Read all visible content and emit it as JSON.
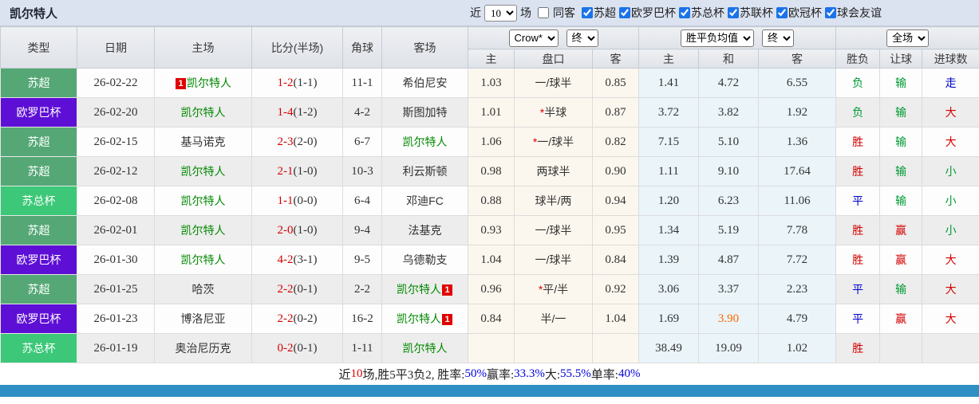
{
  "title": "凯尔特人",
  "filters": {
    "near_label": "近",
    "near_count": "10",
    "matches_label": "场",
    "same_venue_label": "同客",
    "same_venue_checked": false,
    "leagues": [
      {
        "label": "苏超",
        "checked": true
      },
      {
        "label": "欧罗巴杯",
        "checked": true
      },
      {
        "label": "苏总杯",
        "checked": true
      },
      {
        "label": "苏联杯",
        "checked": true
      },
      {
        "label": "欧冠杯",
        "checked": true
      },
      {
        "label": "球会友谊",
        "checked": true
      }
    ]
  },
  "table": {
    "columns": [
      "类型",
      "日期",
      "主场",
      "比分(半场)",
      "角球",
      "客场"
    ],
    "crow_group": {
      "select_company": "Crow*",
      "select_time": "终"
    },
    "avg_group": {
      "select_kind": "胜平负均值",
      "select_time": "终"
    },
    "result_group": {
      "select_scope": "全场"
    },
    "sub": [
      "主",
      "盘口",
      "客",
      "主",
      "和",
      "客",
      "胜负",
      "让球",
      "进球数"
    ],
    "rows": [
      {
        "league": "苏超",
        "date": "26-02-22",
        "home": "凯尔特人",
        "home_card": "1",
        "home_self": true,
        "score": "1-2",
        "half": "(1-1)",
        "corner": "11-1",
        "away": "希伯尼安",
        "away_card": "",
        "away_self": false,
        "o1": "1.03",
        "hcp": "一/球半",
        "star": false,
        "o2": "0.85",
        "a1": "1.41",
        "a2": "4.72",
        "a3": "6.55",
        "a2c": "",
        "res": "负",
        "resc": "green",
        "let": "输",
        "letc": "green",
        "goal": "走",
        "goalc": "blue"
      },
      {
        "league": "欧罗巴杯",
        "date": "26-02-20",
        "home": "凯尔特人",
        "home_card": "",
        "home_self": true,
        "score": "1-4",
        "half": "(1-2)",
        "corner": "4-2",
        "away": "斯图加特",
        "away_card": "",
        "away_self": false,
        "o1": "1.01",
        "hcp": "半球",
        "star": true,
        "o2": "0.87",
        "a1": "3.72",
        "a2": "3.82",
        "a3": "1.92",
        "a2c": "",
        "res": "负",
        "resc": "green",
        "let": "输",
        "letc": "green",
        "goal": "大",
        "goalc": "red"
      },
      {
        "league": "苏超",
        "date": "26-02-15",
        "home": "基马诺克",
        "home_card": "",
        "home_self": false,
        "score": "2-3",
        "half": "(2-0)",
        "corner": "6-7",
        "away": "凯尔特人",
        "away_card": "",
        "away_self": true,
        "o1": "1.06",
        "hcp": "一/球半",
        "star": true,
        "o2": "0.82",
        "a1": "7.15",
        "a2": "5.10",
        "a3": "1.36",
        "a2c": "",
        "res": "胜",
        "resc": "red",
        "let": "输",
        "letc": "green",
        "goal": "大",
        "goalc": "red"
      },
      {
        "league": "苏超",
        "date": "26-02-12",
        "home": "凯尔特人",
        "home_card": "",
        "home_self": true,
        "score": "2-1",
        "half": "(1-0)",
        "corner": "10-3",
        "away": "利云斯顿",
        "away_card": "",
        "away_self": false,
        "o1": "0.98",
        "hcp": "两球半",
        "star": false,
        "o2": "0.90",
        "a1": "1.11",
        "a2": "9.10",
        "a3": "17.64",
        "a2c": "",
        "res": "胜",
        "resc": "red",
        "let": "输",
        "letc": "green",
        "goal": "小",
        "goalc": "green"
      },
      {
        "league": "苏总杯",
        "date": "26-02-08",
        "home": "凯尔特人",
        "home_card": "",
        "home_self": true,
        "score": "1-1",
        "half": "(0-0)",
        "corner": "6-4",
        "away": "邓迪FC",
        "away_card": "",
        "away_self": false,
        "o1": "0.88",
        "hcp": "球半/两",
        "star": false,
        "o2": "0.94",
        "a1": "1.20",
        "a2": "6.23",
        "a3": "11.06",
        "a2c": "",
        "res": "平",
        "resc": "blue",
        "let": "输",
        "letc": "green",
        "goal": "小",
        "goalc": "green"
      },
      {
        "league": "苏超",
        "date": "26-02-01",
        "home": "凯尔特人",
        "home_card": "",
        "home_self": true,
        "score": "2-0",
        "half": "(1-0)",
        "corner": "9-4",
        "away": "法基克",
        "away_card": "",
        "away_self": false,
        "o1": "0.93",
        "hcp": "一/球半",
        "star": false,
        "o2": "0.95",
        "a1": "1.34",
        "a2": "5.19",
        "a3": "7.78",
        "a2c": "",
        "res": "胜",
        "resc": "red",
        "let": "赢",
        "letc": "red",
        "goal": "小",
        "goalc": "green"
      },
      {
        "league": "欧罗巴杯",
        "date": "26-01-30",
        "home": "凯尔特人",
        "home_card": "",
        "home_self": true,
        "score": "4-2",
        "half": "(3-1)",
        "corner": "9-5",
        "away": "乌德勒支",
        "away_card": "",
        "away_self": false,
        "o1": "1.04",
        "hcp": "一/球半",
        "star": false,
        "o2": "0.84",
        "a1": "1.39",
        "a2": "4.87",
        "a3": "7.72",
        "a2c": "",
        "res": "胜",
        "resc": "red",
        "let": "赢",
        "letc": "red",
        "goal": "大",
        "goalc": "red"
      },
      {
        "league": "苏超",
        "date": "26-01-25",
        "home": "哈茨",
        "home_card": "",
        "home_self": false,
        "score": "2-2",
        "half": "(0-1)",
        "corner": "2-2",
        "away": "凯尔特人",
        "away_card": "1",
        "away_self": true,
        "o1": "0.96",
        "hcp": "平/半",
        "star": true,
        "o2": "0.92",
        "a1": "3.06",
        "a2": "3.37",
        "a3": "2.23",
        "a2c": "",
        "res": "平",
        "resc": "blue",
        "let": "输",
        "letc": "green",
        "goal": "大",
        "goalc": "red"
      },
      {
        "league": "欧罗巴杯",
        "date": "26-01-23",
        "home": "博洛尼亚",
        "home_card": "",
        "home_self": false,
        "score": "2-2",
        "half": "(0-2)",
        "corner": "16-2",
        "away": "凯尔特人",
        "away_card": "1",
        "away_self": true,
        "o1": "0.84",
        "hcp": "半/一",
        "star": false,
        "o2": "1.04",
        "a1": "1.69",
        "a2": "3.90",
        "a3": "4.79",
        "a2c": "orange",
        "res": "平",
        "resc": "blue",
        "let": "赢",
        "letc": "red",
        "goal": "大",
        "goalc": "red"
      },
      {
        "league": "苏总杯",
        "date": "26-01-19",
        "home": "奥治尼历克",
        "home_card": "",
        "home_self": false,
        "score": "0-2",
        "half": "(0-1)",
        "corner": "1-11",
        "away": "凯尔特人",
        "away_card": "",
        "away_self": true,
        "o1": "",
        "hcp": "",
        "star": false,
        "o2": "",
        "a1": "38.49",
        "a2": "19.09",
        "a3": "1.02",
        "a2c": "",
        "res": "胜",
        "resc": "red",
        "let": "",
        "letc": "",
        "goal": "",
        "goalc": ""
      }
    ]
  },
  "summary": {
    "segments": [
      {
        "t": "近",
        "c": ""
      },
      {
        "t": "10",
        "c": "red"
      },
      {
        "t": "场,胜5平3负2, 胜率:",
        "c": ""
      },
      {
        "t": "50%",
        "c": "blue"
      },
      {
        "t": " 赢率:",
        "c": ""
      },
      {
        "t": "33.3%",
        "c": "blue"
      },
      {
        "t": " 大:",
        "c": ""
      },
      {
        "t": "55.5%",
        "c": "blue"
      },
      {
        "t": " 单率:",
        "c": ""
      },
      {
        "t": "40%",
        "c": "blue"
      }
    ]
  },
  "colors": {
    "red": "#d40000",
    "green": "#009933",
    "blue": "#0000cc",
    "orange": "#ff6600",
    "league": {
      "苏超": "#55a876",
      "欧罗巴杯": "#5e0fd6",
      "苏总杯": "#3cc878"
    },
    "bottom_bar": "#2d8fc3",
    "topbar_bg": "#dbe2f0"
  }
}
